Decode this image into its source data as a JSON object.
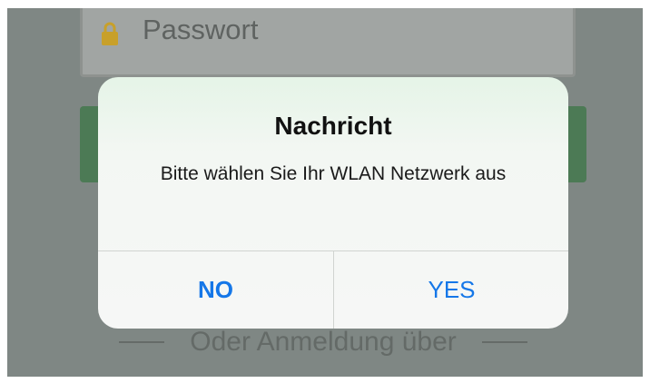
{
  "background_screen": {
    "password_field": {
      "placeholder": "Passwort",
      "icon": "lock-icon"
    },
    "alternative_login_label": "Oder Anmeldung über"
  },
  "alert": {
    "title": "Nachricht",
    "message": "Bitte wählen Sie Ihr WLAN Netzwerk aus",
    "buttons": {
      "no": "NO",
      "yes": "YES"
    }
  },
  "colors": {
    "accent": "#1577e8",
    "login_button": "#4c7a55",
    "lock_icon": "#c8a02a"
  }
}
